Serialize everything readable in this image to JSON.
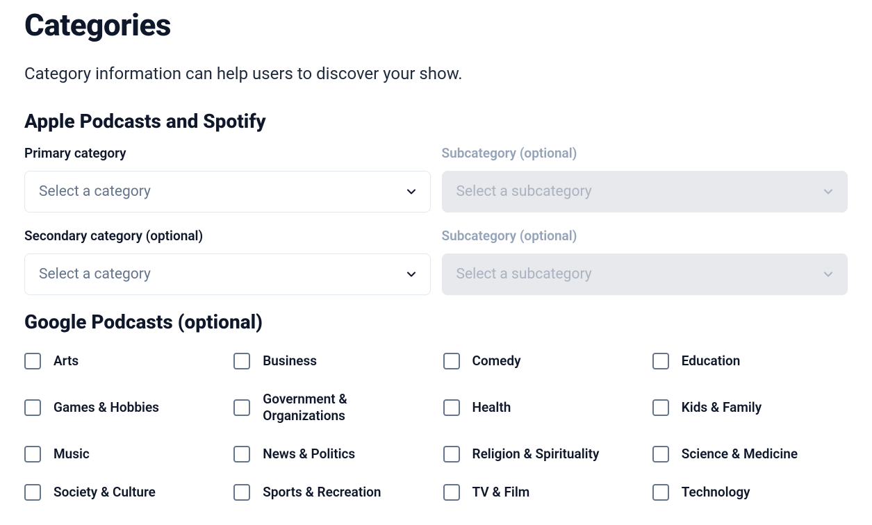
{
  "header": {
    "title": "Categories",
    "description": "Category information can help users to discover your show."
  },
  "apple_spotify": {
    "heading": "Apple Podcasts and Spotify",
    "primary": {
      "label": "Primary category",
      "placeholder": "Select a category",
      "sub_label": "Subcategory (optional)",
      "sub_placeholder": "Select a subcategory"
    },
    "secondary": {
      "label": "Secondary category (optional)",
      "placeholder": "Select a category",
      "sub_label": "Subcategory (optional)",
      "sub_placeholder": "Select a subcategory"
    }
  },
  "google": {
    "heading": "Google Podcasts (optional)",
    "categories": [
      "Arts",
      "Business",
      "Comedy",
      "Education",
      "Games & Hobbies",
      "Government & Organizations",
      "Health",
      "Kids & Family",
      "Music",
      "News & Politics",
      "Religion & Spirituality",
      "Science & Medicine",
      "Society & Culture",
      "Sports & Recreation",
      "TV & Film",
      "Technology"
    ]
  }
}
